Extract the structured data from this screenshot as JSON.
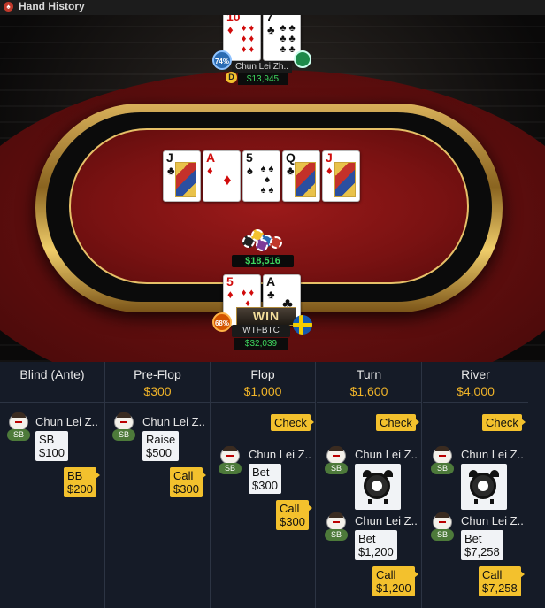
{
  "window": {
    "title": "Hand History"
  },
  "table": {
    "top_player": {
      "name": "Chun Lei Zh..",
      "stack": "$13,945",
      "equity": "74%",
      "dealer": "D",
      "cards": [
        {
          "rank": "10",
          "suit": "♦",
          "color": "red"
        },
        {
          "rank": "7",
          "suit": "♣",
          "color": "black"
        }
      ]
    },
    "board": [
      {
        "rank": "J",
        "suit": "♣",
        "color": "black",
        "face": true
      },
      {
        "rank": "A",
        "suit": "♦",
        "color": "red",
        "face": false
      },
      {
        "rank": "5",
        "suit": "♠",
        "color": "black",
        "face": false
      },
      {
        "rank": "Q",
        "suit": "♣",
        "color": "black",
        "face": true
      },
      {
        "rank": "J",
        "suit": "♦",
        "color": "red",
        "face": true
      }
    ],
    "pot": "$18,516",
    "hero": {
      "name": "WTFBTC",
      "stack": "$32,039",
      "equity": "68%",
      "result": "WIN",
      "cards": [
        {
          "rank": "5",
          "suit": "♦",
          "color": "red"
        },
        {
          "rank": "A",
          "suit": "♣",
          "color": "black"
        }
      ]
    }
  },
  "history": {
    "columns": [
      {
        "name": "Blind (Ante)",
        "amount": ""
      },
      {
        "name": "Pre-Flop",
        "amount": "$300"
      },
      {
        "name": "Flop",
        "amount": "$1,000"
      },
      {
        "name": "Turn",
        "amount": "$1,600"
      },
      {
        "name": "River",
        "amount": "$4,000"
      }
    ],
    "player_name": "Chun Lei Z..",
    "position": "SB",
    "blind": {
      "sb_action": "SB",
      "sb_amount": "$100",
      "bb_action": "BB",
      "bb_amount": "$200"
    },
    "preflop": {
      "action": "Raise",
      "amount": "$500",
      "resp_action": "Call",
      "resp_amount": "$300"
    },
    "flop": {
      "opp_action": "Check",
      "action": "Bet",
      "amount": "$300",
      "resp_action": "Call",
      "resp_amount": "$300"
    },
    "turn": {
      "opp_action": "Check",
      "action": "Bet",
      "amount": "$1,200",
      "resp_action": "Call",
      "resp_amount": "$1,200"
    },
    "river": {
      "opp_action": "Check",
      "action": "Bet",
      "amount": "$7,258",
      "resp_action": "Call",
      "resp_amount": "$7,258"
    }
  },
  "colors": {
    "accent_gold": "#f3c12d",
    "stack_green": "#3ed65e",
    "felt_red": "#9c1a1a"
  },
  "icons": [
    "poker-logo-icon",
    "timebank-clock-icon",
    "flag-sweden-icon",
    "flag-player-icon",
    "dealer-button-icon",
    "chip-stack-icon"
  ]
}
